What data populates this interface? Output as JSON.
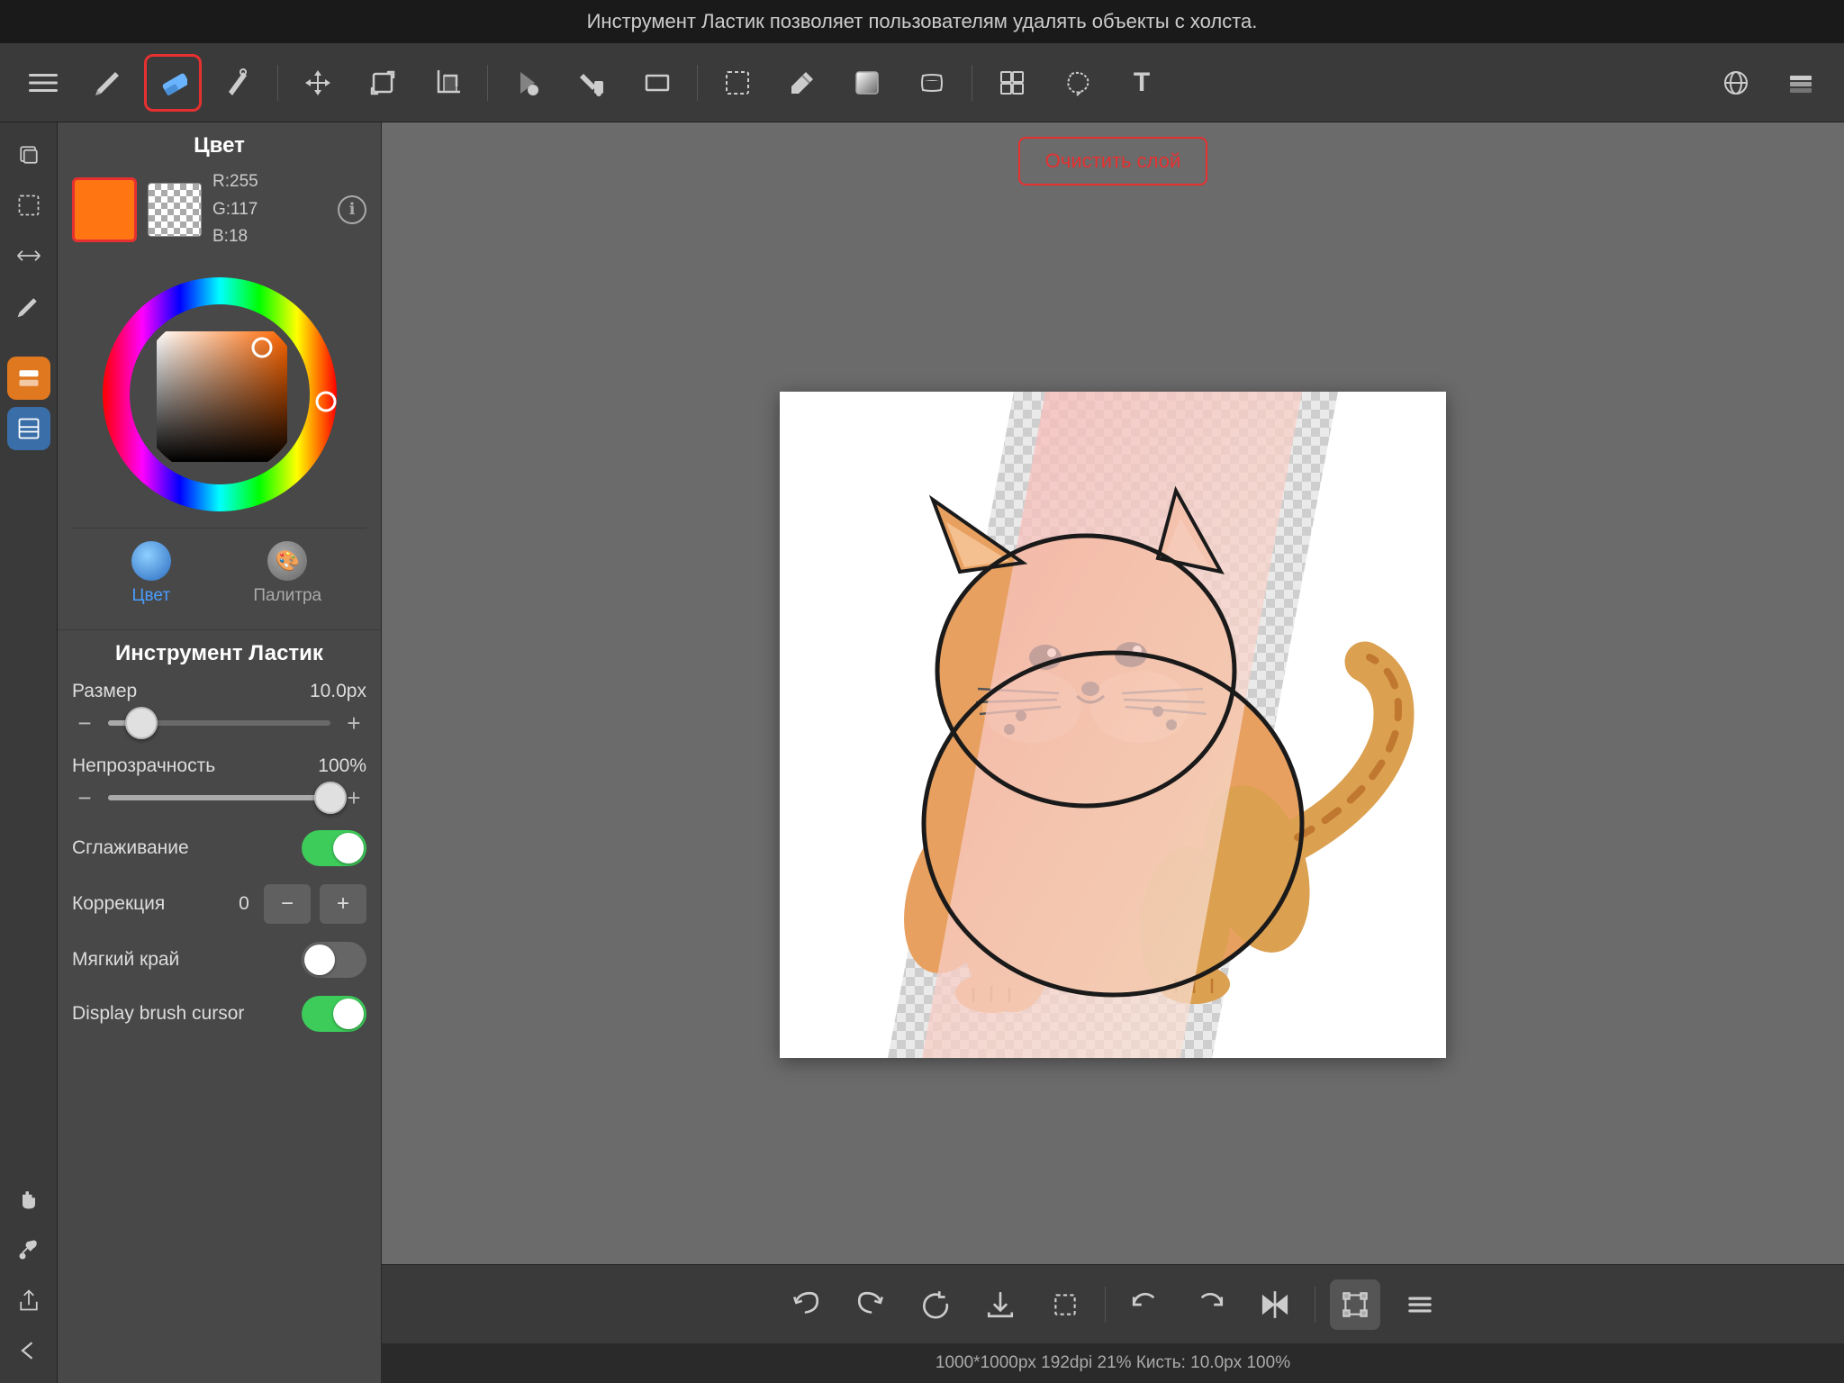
{
  "notification": {
    "text": "Инструмент Ластик позволяет пользователям удалять объекты с холста."
  },
  "toolbar": {
    "tools": [
      {
        "id": "menu",
        "label": "☰"
      },
      {
        "id": "pencil",
        "label": "✏"
      },
      {
        "id": "eraser",
        "label": "◆",
        "active": true
      },
      {
        "id": "select-pen",
        "label": "✒"
      },
      {
        "id": "move",
        "label": "✛"
      },
      {
        "id": "expand",
        "label": "⬜"
      },
      {
        "id": "crop",
        "label": "⊡"
      },
      {
        "id": "fill",
        "label": "⬟"
      },
      {
        "id": "paint-bucket",
        "label": "⬟"
      },
      {
        "id": "rectangle",
        "label": "▭"
      },
      {
        "id": "selection-rect",
        "label": "⬚"
      },
      {
        "id": "color-pick",
        "label": "🖊"
      },
      {
        "id": "gradient",
        "label": "◈"
      },
      {
        "id": "smudge",
        "label": "◇"
      },
      {
        "id": "layers-grid",
        "label": "⊞"
      },
      {
        "id": "lasso",
        "label": "⌕"
      },
      {
        "id": "text",
        "label": "T"
      },
      {
        "id": "globe",
        "label": "🌐"
      },
      {
        "id": "layers",
        "label": "⧉"
      }
    ]
  },
  "color_panel": {
    "title": "Цвет",
    "primary_color": "#ff7512",
    "r": 255,
    "g": 117,
    "b": 18,
    "info_label": "ℹ",
    "tabs": [
      {
        "id": "color",
        "label": "Цвет",
        "active": true
      },
      {
        "id": "palette",
        "label": "Палитра",
        "active": false
      }
    ]
  },
  "tool_panel": {
    "title": "Инструмент Ластик",
    "size_label": "Размер",
    "size_value": "10.0px",
    "size_fill_pct": 15,
    "size_thumb_pct": 15,
    "opacity_label": "Непрозрачность",
    "opacity_value": "100%",
    "opacity_fill_pct": 100,
    "opacity_thumb_pct": 100,
    "smoothing_label": "Сглаживание",
    "smoothing_on": true,
    "correction_label": "Коррекция",
    "correction_value": "0",
    "soft_edge_label": "Мягкий край",
    "soft_edge_on": false,
    "display_brush_label": "Display brush cursor",
    "display_brush_on": true,
    "minus_label": "−",
    "plus_label": "+"
  },
  "canvas": {
    "clear_layer_label": "Очистить слой"
  },
  "bottom_toolbar": {
    "buttons": [
      {
        "id": "undo",
        "label": "↩"
      },
      {
        "id": "redo",
        "label": "↪"
      },
      {
        "id": "refresh",
        "label": "↻"
      },
      {
        "id": "download",
        "label": "⬇"
      },
      {
        "id": "crop-sel",
        "label": "⬚"
      },
      {
        "id": "rotate-ccw",
        "label": "↺"
      },
      {
        "id": "rotate-cw",
        "label": "↻"
      },
      {
        "id": "flip",
        "label": "↕"
      },
      {
        "id": "transform",
        "label": "▣"
      },
      {
        "id": "more",
        "label": "≡"
      }
    ]
  },
  "status_bar": {
    "text": "1000*1000px 192dpi 21% Кисть: 10.0px 100%"
  },
  "side_panel": {
    "buttons": [
      {
        "id": "duplicate",
        "label": "⧉"
      },
      {
        "id": "selection",
        "label": "⬚"
      },
      {
        "id": "transform-side",
        "label": "↔"
      },
      {
        "id": "brush",
        "label": "✏"
      },
      {
        "id": "layer-orange",
        "label": "▣",
        "active_orange": true
      },
      {
        "id": "layer-blue",
        "label": "▣",
        "active_blue": true
      },
      {
        "id": "hand",
        "label": "✋"
      },
      {
        "id": "eyedrop",
        "label": "💧"
      },
      {
        "id": "share",
        "label": "↗"
      },
      {
        "id": "back",
        "label": "↩"
      }
    ]
  }
}
